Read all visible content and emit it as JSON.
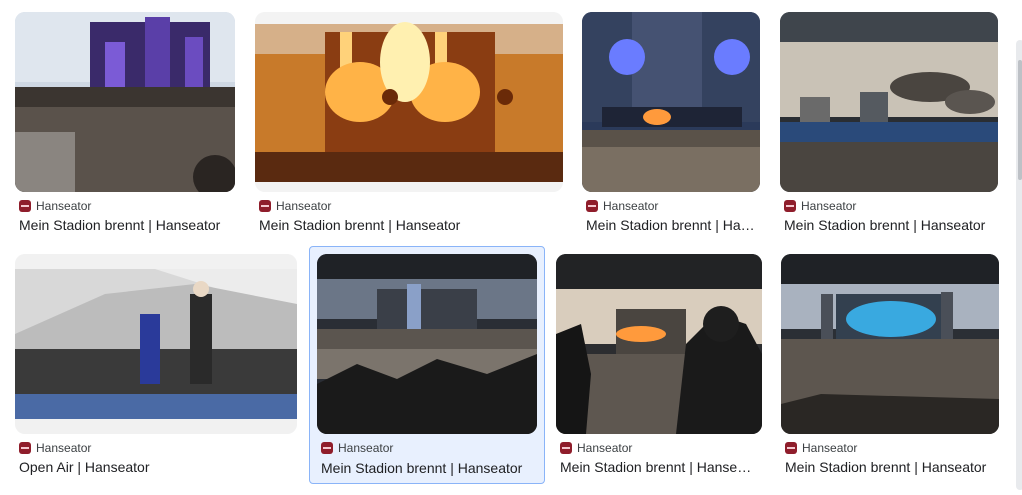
{
  "results": [
    {
      "source": "Hanseator",
      "title": "Mein Stadion brennt | Hanseator",
      "favicon": "hanseator-favicon-icon",
      "scene": "stadium-concert-purple"
    },
    {
      "source": "Hanseator",
      "title": "Mein Stadion brennt | Hanseator",
      "favicon": "hanseator-favicon-icon",
      "scene": "stage-fire"
    },
    {
      "source": "Hanseator",
      "title": "Mein Stadion brennt | Hanseator",
      "favicon": "hanseator-favicon-icon",
      "scene": "stage-night"
    },
    {
      "source": "Hanseator",
      "title": "Mein Stadion brennt | Hanseator",
      "favicon": "hanseator-favicon-icon",
      "scene": "stadium-smoke"
    },
    {
      "source": "Hanseator",
      "title": "Open Air | Hanseator",
      "favicon": "hanseator-favicon-icon",
      "scene": "open-air-orchestra"
    },
    {
      "source": "Hanseator",
      "title": "Mein Stadion brennt | Hanseator",
      "favicon": "hanseator-favicon-icon",
      "scene": "stadium-crowd-hands",
      "selected": true
    },
    {
      "source": "Hanseator",
      "title": "Mein Stadion brennt | Hanseator",
      "favicon": "hanseator-favicon-icon",
      "scene": "stadium-spectator"
    },
    {
      "source": "Hanseator",
      "title": "Mein Stadion brennt | Hanseator",
      "favicon": "hanseator-favicon-icon",
      "scene": "stadium-blue-smoke"
    }
  ],
  "colors": {
    "selected_border": "#8ab4f8",
    "selected_bg": "#e8f0fe",
    "favicon": "#8f1d2b",
    "title_text": "#202124",
    "source_text": "#3c4043"
  }
}
